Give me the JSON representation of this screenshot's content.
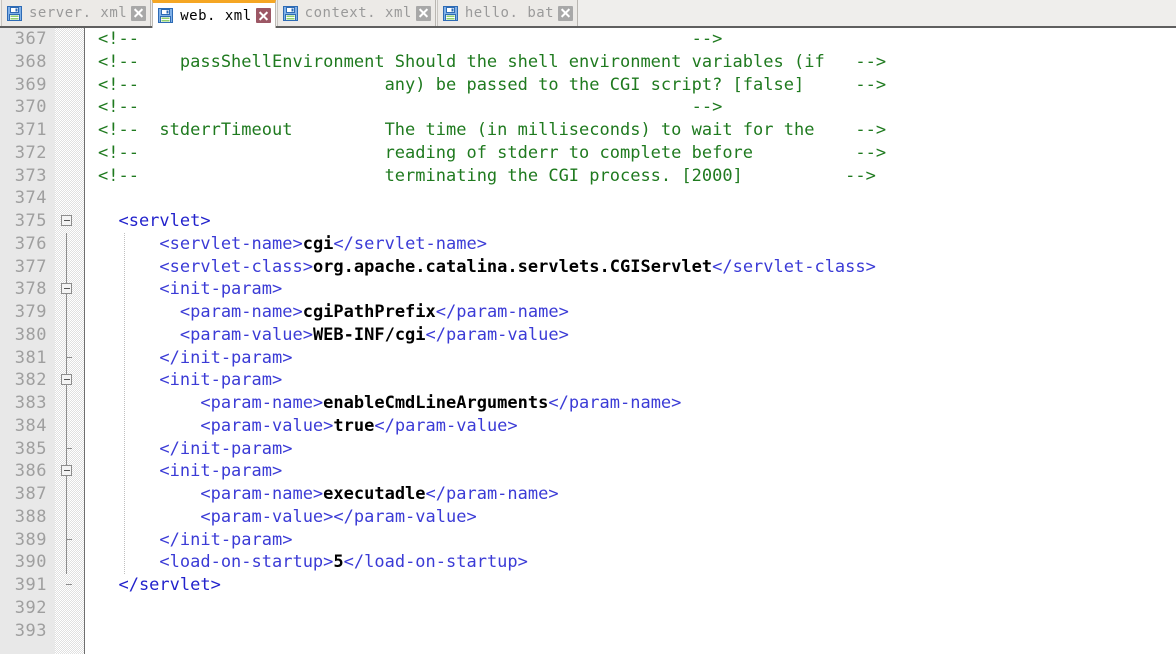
{
  "window": {
    "title": "web.xml",
    "colors": {
      "active_tab_accent": "#f5a623",
      "comment": "#1f7a1f",
      "tag": "#3b3bd6",
      "text_value": "#000000",
      "gutter_bg": "#e8e8e8",
      "line_number": "#9f9f9f"
    }
  },
  "tabs": [
    {
      "label": "server. xml",
      "icon": "floppy-disk-icon",
      "close_icon": "close-icon",
      "active": false
    },
    {
      "label": "web. xml",
      "icon": "floppy-disk-icon",
      "close_icon": "close-icon",
      "active": true
    },
    {
      "label": "context. xml",
      "icon": "floppy-disk-icon",
      "close_icon": "close-icon",
      "active": false
    },
    {
      "label": "hello. bat",
      "icon": "floppy-disk-icon",
      "close_icon": "close-icon",
      "active": false
    }
  ],
  "editor": {
    "first_line": 367,
    "last_line": 393,
    "lines": [
      {
        "n": 367,
        "fold": "none",
        "spine": false,
        "segments": [
          {
            "t": "cm",
            "s": "<!--                                                      -->"
          }
        ]
      },
      {
        "n": 368,
        "fold": "none",
        "spine": false,
        "segments": [
          {
            "t": "cm",
            "s": "<!--    passShellEnvironment Should the shell environment variables (if   -->"
          }
        ]
      },
      {
        "n": 369,
        "fold": "none",
        "spine": false,
        "segments": [
          {
            "t": "cm",
            "s": "<!--                        any) be passed to the CGI script? [false]     -->"
          }
        ]
      },
      {
        "n": 370,
        "fold": "none",
        "spine": false,
        "segments": [
          {
            "t": "cm",
            "s": "<!--                                                      -->"
          }
        ]
      },
      {
        "n": 371,
        "fold": "none",
        "spine": false,
        "segments": [
          {
            "t": "cm",
            "s": "<!--  stderrTimeout         The time (in milliseconds) to wait for the    -->"
          }
        ]
      },
      {
        "n": 372,
        "fold": "none",
        "spine": false,
        "segments": [
          {
            "t": "cm",
            "s": "<!--                        reading of stderr to complete before          -->"
          }
        ]
      },
      {
        "n": 373,
        "fold": "none",
        "spine": false,
        "segments": [
          {
            "t": "cm",
            "s": "<!--                        terminating the CGI process. [2000]          -->"
          }
        ]
      },
      {
        "n": 374,
        "fold": "none",
        "spine": false,
        "segments": []
      },
      {
        "n": 375,
        "fold": "minus",
        "spine": false,
        "segments": [
          {
            "t": "tg2",
            "s": "  <servlet>"
          }
        ]
      },
      {
        "n": 376,
        "fold": "spine",
        "spine": true,
        "segments": [
          {
            "t": "tg",
            "s": "      <servlet-name>"
          },
          {
            "t": "tx",
            "s": "cgi"
          },
          {
            "t": "tg",
            "s": "</servlet-name>"
          }
        ]
      },
      {
        "n": 377,
        "fold": "spine",
        "spine": true,
        "segments": [
          {
            "t": "tg",
            "s": "      <servlet-class>"
          },
          {
            "t": "tx",
            "s": "org.apache.catalina.servlets.CGIServlet"
          },
          {
            "t": "tg",
            "s": "</servlet-class>"
          }
        ]
      },
      {
        "n": 378,
        "fold": "minus",
        "spine": true,
        "segments": [
          {
            "t": "tg",
            "s": "      <init-param>"
          }
        ]
      },
      {
        "n": 379,
        "fold": "spine",
        "spine": true,
        "segments": [
          {
            "t": "tg",
            "s": "        <param-name>"
          },
          {
            "t": "tx",
            "s": "cgiPathPrefix"
          },
          {
            "t": "tg",
            "s": "</param-name>"
          }
        ]
      },
      {
        "n": 380,
        "fold": "spine",
        "spine": true,
        "segments": [
          {
            "t": "tg",
            "s": "        <param-value>"
          },
          {
            "t": "tx",
            "s": "WEB-INF/cgi"
          },
          {
            "t": "tg",
            "s": "</param-value>"
          }
        ]
      },
      {
        "n": 381,
        "fold": "end",
        "spine": true,
        "segments": [
          {
            "t": "tg",
            "s": "      </init-param>"
          }
        ]
      },
      {
        "n": 382,
        "fold": "minus",
        "spine": true,
        "segments": [
          {
            "t": "tg",
            "s": "      <init-param>"
          }
        ]
      },
      {
        "n": 383,
        "fold": "spine",
        "spine": true,
        "segments": [
          {
            "t": "tg",
            "s": "          <param-name>"
          },
          {
            "t": "tx",
            "s": "enableCmdLineArguments"
          },
          {
            "t": "tg",
            "s": "</param-name>"
          }
        ]
      },
      {
        "n": 384,
        "fold": "spine",
        "spine": true,
        "segments": [
          {
            "t": "tg",
            "s": "          <param-value>"
          },
          {
            "t": "tx",
            "s": "true"
          },
          {
            "t": "tg",
            "s": "</param-value>"
          }
        ]
      },
      {
        "n": 385,
        "fold": "end",
        "spine": true,
        "segments": [
          {
            "t": "tg",
            "s": "      </init-param>"
          }
        ]
      },
      {
        "n": 386,
        "fold": "minus",
        "spine": true,
        "segments": [
          {
            "t": "tg",
            "s": "      <init-param>"
          }
        ]
      },
      {
        "n": 387,
        "fold": "spine",
        "spine": true,
        "segments": [
          {
            "t": "tg",
            "s": "          <param-name>"
          },
          {
            "t": "tx",
            "s": "executadle"
          },
          {
            "t": "tg",
            "s": "</param-name>"
          }
        ]
      },
      {
        "n": 388,
        "fold": "spine",
        "spine": true,
        "segments": [
          {
            "t": "tg",
            "s": "          <param-value>"
          },
          {
            "t": "tg",
            "s": "</param-value>"
          }
        ]
      },
      {
        "n": 389,
        "fold": "end",
        "spine": true,
        "segments": [
          {
            "t": "tg",
            "s": "      </init-param>"
          }
        ]
      },
      {
        "n": 390,
        "fold": "spine",
        "spine": true,
        "segments": [
          {
            "t": "tg",
            "s": "      <load-on-startup>"
          },
          {
            "t": "tx",
            "s": "5"
          },
          {
            "t": "tg",
            "s": "</load-on-startup>"
          }
        ]
      },
      {
        "n": 391,
        "fold": "end",
        "spine": false,
        "segments": [
          {
            "t": "tg2",
            "s": "  </servlet>"
          }
        ]
      },
      {
        "n": 392,
        "fold": "none",
        "spine": false,
        "segments": []
      },
      {
        "n": 393,
        "fold": "none",
        "spine": false,
        "segments": []
      }
    ]
  }
}
